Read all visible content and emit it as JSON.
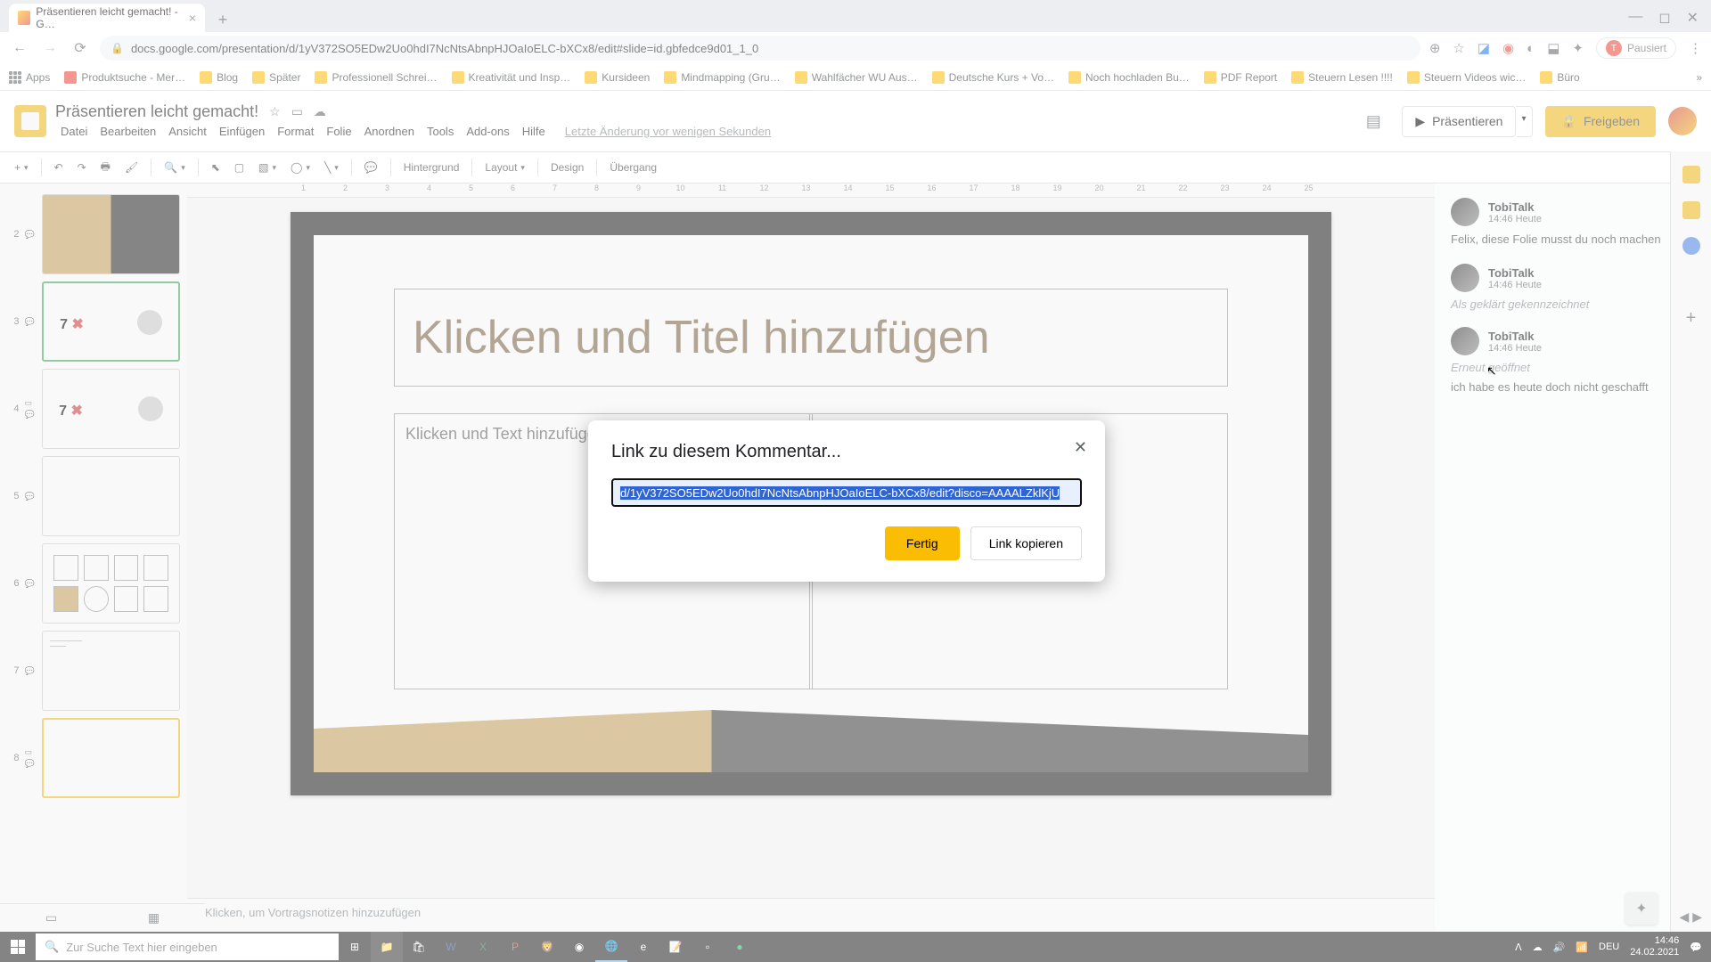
{
  "browser": {
    "tab_title": "Präsentieren leicht gemacht! - G…",
    "url": "docs.google.com/presentation/d/1yV372SO5EDw2Uo0hdI7NcNtsAbnpHJOaIoELC-bXCx8/edit#slide=id.gbfedce9d01_1_0",
    "pausiert": "Pausiert"
  },
  "bookmarks": [
    "Apps",
    "Produktsuche - Mer…",
    "Blog",
    "Später",
    "Professionell Schrei…",
    "Kreativität und Insp…",
    "Kursideen",
    "Mindmapping (Gru…",
    "Wahlfächer WU Aus…",
    "Deutsche Kurs + Vo…",
    "Noch hochladen Bu…",
    "PDF Report",
    "Steuern Lesen !!!!",
    "Steuern Videos wic…",
    "Büro"
  ],
  "doc": {
    "title": "Präsentieren leicht gemacht!",
    "menus": [
      "Datei",
      "Bearbeiten",
      "Ansicht",
      "Einfügen",
      "Format",
      "Folie",
      "Anordnen",
      "Tools",
      "Add-ons",
      "Hilfe"
    ],
    "last_change": "Letzte Änderung vor wenigen Sekunden",
    "present": "Präsentieren",
    "share": "Freigeben"
  },
  "toolbar": {
    "hintergrund": "Hintergrund",
    "layout": "Layout",
    "design": "Design",
    "uebergang": "Übergang"
  },
  "slide": {
    "title_ph": "Klicken und Titel hinzufügen",
    "body_ph": "Klicken und Text hinzufügen",
    "notes_ph": "Klicken, um Vortragsnotizen hinzuzufügen"
  },
  "thumbs": [
    "2",
    "3",
    "4",
    "5",
    "6",
    "7",
    "8"
  ],
  "ruler": [
    "",
    "1",
    "2",
    "3",
    "4",
    "5",
    "6",
    "7",
    "8",
    "9",
    "10",
    "11",
    "12",
    "13",
    "14",
    "15",
    "16",
    "17",
    "18",
    "19",
    "20",
    "21",
    "22",
    "23",
    "24",
    "25"
  ],
  "comments": [
    {
      "name": "TobiTalk",
      "time": "14:46 Heute",
      "body": "Felix, diese Folie musst du noch machen",
      "has_check": true
    },
    {
      "name": "TobiTalk",
      "time": "14:46 Heute",
      "status": "Als geklärt gekennzeichnet"
    },
    {
      "name": "TobiTalk",
      "time": "14:46 Heute",
      "status": "Erneut geöffnet",
      "body": "ich habe es heute doch nicht geschafft"
    }
  ],
  "modal": {
    "title": "Link zu diesem Kommentar...",
    "link": "d/1yV372SO5EDw2Uo0hdI7NcNtsAbnpHJOaIoELC-bXCx8/edit?disco=AAAALZklKjU",
    "done": "Fertig",
    "copy": "Link kopieren"
  },
  "taskbar": {
    "search_ph": "Zur Suche Text hier eingeben",
    "lang": "DEU",
    "time": "14:46",
    "date": "24.02.2021"
  }
}
